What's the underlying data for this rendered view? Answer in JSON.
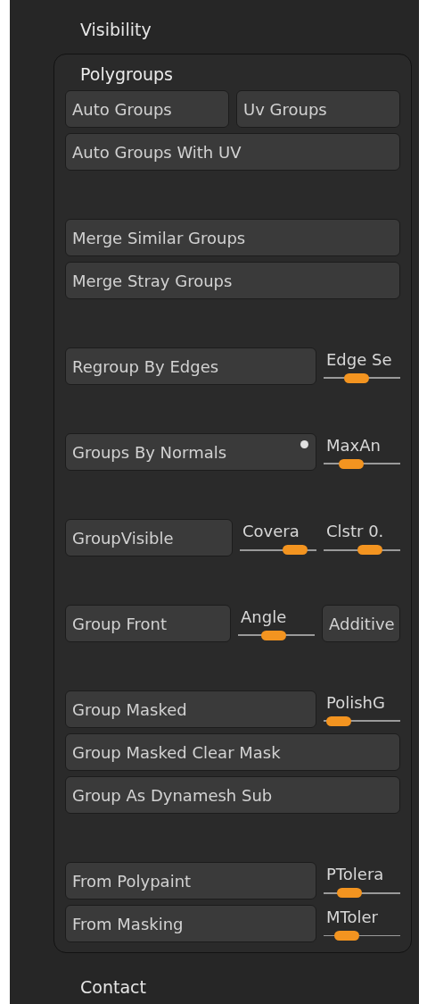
{
  "header": "Visibility",
  "panel": {
    "title": "Polygroups",
    "expanded": true,
    "groups": [
      {
        "rows": [
          [
            {
              "kind": "button",
              "label": "Auto Groups"
            },
            {
              "kind": "button",
              "label": "Uv Groups"
            }
          ],
          [
            {
              "kind": "button",
              "label": "Auto Groups With UV"
            }
          ]
        ]
      },
      {
        "rows": [
          [
            {
              "kind": "button",
              "label": "Merge Similar Groups"
            }
          ],
          [
            {
              "kind": "button",
              "label": "Merge Stray Groups"
            }
          ]
        ]
      },
      {
        "rows": [
          [
            {
              "kind": "button",
              "label": "Regroup By Edges"
            },
            {
              "kind": "slider",
              "label": "Edge Se",
              "level": 0.4
            }
          ]
        ]
      },
      {
        "rows": [
          [
            {
              "kind": "button",
              "label": "Groups By Normals",
              "indicator_on": true
            },
            {
              "kind": "slider",
              "label": "MaxAn",
              "level": 0.3
            }
          ]
        ]
      },
      {
        "rows": [
          [
            {
              "kind": "button",
              "label": "GroupVisible"
            },
            {
              "kind": "slider",
              "label": "Covera",
              "level": 0.82
            },
            {
              "kind": "slider",
              "label": "Clstr 0.",
              "level": 0.65
            }
          ]
        ]
      },
      {
        "rows": [
          [
            {
              "kind": "button",
              "label": "Group Front"
            },
            {
              "kind": "slider",
              "label": "Angle",
              "level": 0.45
            },
            {
              "kind": "button",
              "label": "Additive"
            }
          ]
        ]
      },
      {
        "rows": [
          [
            {
              "kind": "button",
              "label": "Group Masked"
            },
            {
              "kind": "slider",
              "label": "PolishG",
              "level": 0.05
            }
          ],
          [
            {
              "kind": "button",
              "label": "Group Masked Clear Mask"
            }
          ],
          [
            {
              "kind": "button",
              "label": "Group As Dynamesh Sub"
            }
          ]
        ]
      },
      {
        "rows": [
          [
            {
              "kind": "button",
              "label": "From Polypaint"
            },
            {
              "kind": "slider",
              "label": "PTolera",
              "level": 0.25
            }
          ],
          [
            {
              "kind": "button",
              "label": "From Masking"
            },
            {
              "kind": "slider",
              "label": "MToler",
              "level": 0.2
            }
          ]
        ]
      }
    ]
  },
  "footer": "Contact"
}
